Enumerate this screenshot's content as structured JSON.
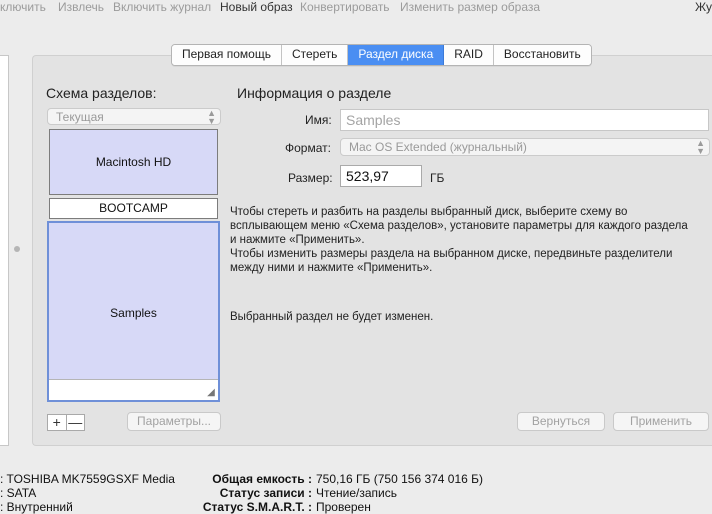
{
  "toolbar": {
    "items": [
      "ключить",
      "Извлечь",
      "Включить журнал",
      "Новый образ",
      "Конвертировать",
      "Изменить размер образа"
    ],
    "right_item": "Жу"
  },
  "tabs": [
    "Первая помощь",
    "Стереть",
    "Раздел диска",
    "RAID",
    "Восстановить"
  ],
  "active_tab": "Раздел диска",
  "scheme": {
    "title": "Схема разделов:",
    "popup_value": "Текущая",
    "partitions": [
      "Macintosh HD",
      "BOOTCAMP",
      "Samples"
    ]
  },
  "info": {
    "title": "Информация о разделе",
    "name_label": "Имя:",
    "name_value": "Samples",
    "format_label": "Формат:",
    "format_value": "Mac OS Extended (журнальный)",
    "size_label": "Размер:",
    "size_value": "523,97",
    "size_unit": "ГБ",
    "instructions": "Чтобы стереть и разбить на разделы выбранный диск, выберите схему во\nвсплывающем меню «Схема разделов», установите параметры для каждого раздела\nи нажмите «Применить».\nЧтобы изменить размеры раздела на выбранном диске, передвиньте разделители\nмежду ними и нажмите «Применить».",
    "status_note": "Выбранный раздел не будет изменен."
  },
  "buttons": {
    "plus": "+",
    "minus": "—",
    "options": "Параметры...",
    "revert": "Вернуться",
    "apply": "Применить"
  },
  "details": {
    "left": [
      ": TOSHIBA MK7559GSXF Media",
      ": SATA",
      ": Внутренний"
    ],
    "right": [
      {
        "key": "Общая емкость :",
        "value": "750,16 ГБ (750 156 374 016 Б)"
      },
      {
        "key": "Статус записи :",
        "value": "Чтение/запись"
      },
      {
        "key": "Статус S.M.A.R.T. :",
        "value": "Проверен"
      }
    ]
  },
  "colors": {
    "accent": "#4a8ef2",
    "partition_fill": "#d7d9f7",
    "selection_border": "#6f90d8"
  }
}
